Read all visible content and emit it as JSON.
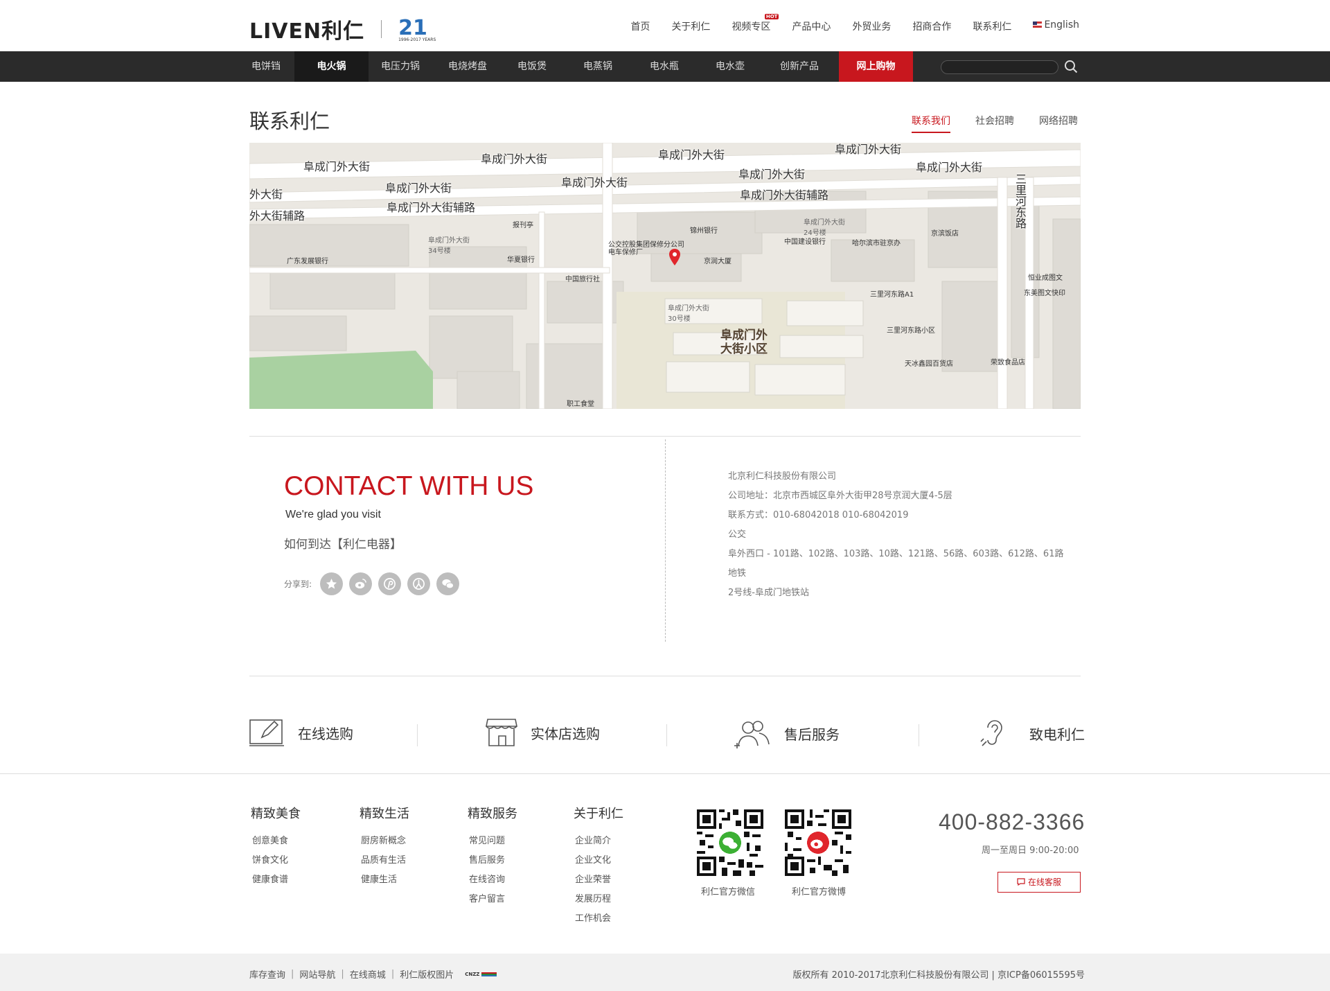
{
  "header": {
    "brand": "LIVEN利仁",
    "anniversary": "21",
    "anniversary_sub": "1996-2017 YEARS",
    "nav": [
      {
        "label": "首页"
      },
      {
        "label": "关于利仁"
      },
      {
        "label": "视频专区",
        "badge": "HOT"
      },
      {
        "label": "产品中心"
      },
      {
        "label": "外贸业务"
      },
      {
        "label": "招商合作"
      },
      {
        "label": "联系利仁"
      },
      {
        "label": "English"
      }
    ]
  },
  "catbar": {
    "items": [
      "电饼铛",
      "电火锅",
      "电压力锅",
      "电烧烤盘",
      "电饭煲",
      "电蒸锅",
      "电水瓶",
      "电水壶",
      "创新产品"
    ],
    "active_index": 1,
    "shop_label": "网上购物",
    "search_placeholder": ""
  },
  "page": {
    "title": "联系利仁",
    "subnav": [
      "联系我们",
      "社会招聘",
      "网络招聘"
    ]
  },
  "map": {
    "roads": [
      "阜成门外大街",
      "阜成门外大街",
      "阜成门外大街",
      "阜成门外大街",
      "阜成门外大街",
      "阜成门外大街",
      "阜成门外大街",
      "阜成门外大街",
      "外大街",
      "外大街辅路",
      "阜成门外大街辅路",
      "阜成门外大街辅路",
      "三里河东路"
    ],
    "pois": [
      "报刊亭",
      "锦州银行",
      "阜成门外大街24号楼",
      "京滨饭店",
      "阜成门外大街34号楼",
      "中国建设银行",
      "哈尔滨市驻京办",
      "广东发展银行",
      "华夏银行",
      "公交控股集团保修分公司电车保修厂",
      "京润大厦",
      "中国旅行社",
      "恒业成图文",
      "东美图文快印",
      "三里河东路A1",
      "阜成门外大街30号楼",
      "三里河东路小区",
      "天冰鑫园百货店",
      "荣致食品店",
      "职工食堂"
    ],
    "area_label": "阜成门外大街小区"
  },
  "contact": {
    "title": "CONTACT WITH US",
    "subtitle": "We're glad you visit",
    "how": "如何到达【利仁电器】",
    "share_label": "分享到:",
    "share_icons": [
      "star-icon",
      "weibo-icon",
      "pinterest-icon",
      "renren-icon",
      "wechat-icon"
    ],
    "info": [
      "北京利仁科技股份有限公司",
      "公司地址：北京市西城区阜外大街甲28号京润大厦4-5层",
      "联系方式：010-68042018 010-68042019",
      "公交",
      "阜外西口 - 101路、102路、103路、10路、121路、56路、603路、612路、61路",
      "地铁",
      "2号线-阜成门地铁站"
    ]
  },
  "services": [
    {
      "label": "在线选购",
      "icon": "edit-icon"
    },
    {
      "label": "实体店选购",
      "icon": "store-icon"
    },
    {
      "label": "售后服务",
      "icon": "users-icon"
    },
    {
      "label": "致电利仁",
      "icon": "ear-icon"
    }
  ],
  "footer": {
    "cols": [
      {
        "title": "精致美食",
        "links": [
          "创意美食",
          "饼食文化",
          "健康食谱"
        ]
      },
      {
        "title": "精致生活",
        "links": [
          "厨房新概念",
          "品质有生活",
          "健康生活"
        ]
      },
      {
        "title": "精致服务",
        "links": [
          "常见问题",
          "售后服务",
          "在线咨询",
          "客户留言"
        ]
      },
      {
        "title": "关于利仁",
        "links": [
          "企业简介",
          "企业文化",
          "企业荣誉",
          "发展历程",
          "工作机会"
        ]
      }
    ],
    "qr": [
      {
        "caption": "利仁官方微信"
      },
      {
        "caption": "利仁官方微博"
      }
    ],
    "phone": "400-882-3366",
    "hours": "周一至周日 9:00-20:00",
    "kefu": "在线客服",
    "bottom_links": [
      "库存查询",
      "网站导航",
      "在线商城",
      "利仁版权图片"
    ],
    "cnzz": "CNZZ",
    "copyright": "版权所有  2010-2017北京利仁科技股份有限公司 | 京ICP备06015595号"
  },
  "colors": {
    "accent": "#c8171e",
    "bar": "#2b2b2b"
  }
}
